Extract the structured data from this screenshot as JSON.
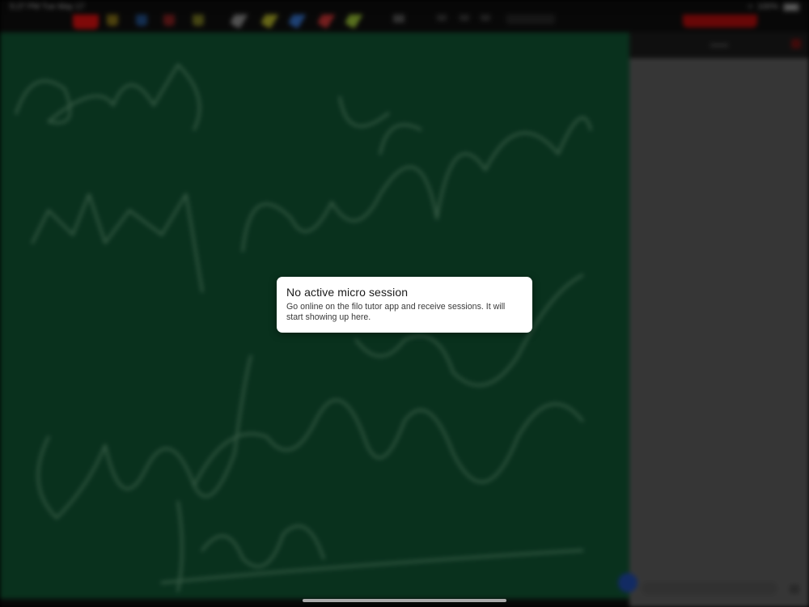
{
  "status_bar": {
    "time": "5:27 PM",
    "date": "Tue May 17",
    "battery": "100%",
    "wifi_icon": "wifi-icon",
    "battery_icon": "battery-icon"
  },
  "toolbar": {
    "more_icon": "more-dots-icon",
    "end_button_color": "#b00d0d",
    "active_tool_color": "#b00d0d"
  },
  "board": {
    "background_color": "#0d4429"
  },
  "dialog": {
    "title": "No active micro session",
    "message": "Go online on the filo tutor app and receive sessions. It will start showing up here."
  }
}
